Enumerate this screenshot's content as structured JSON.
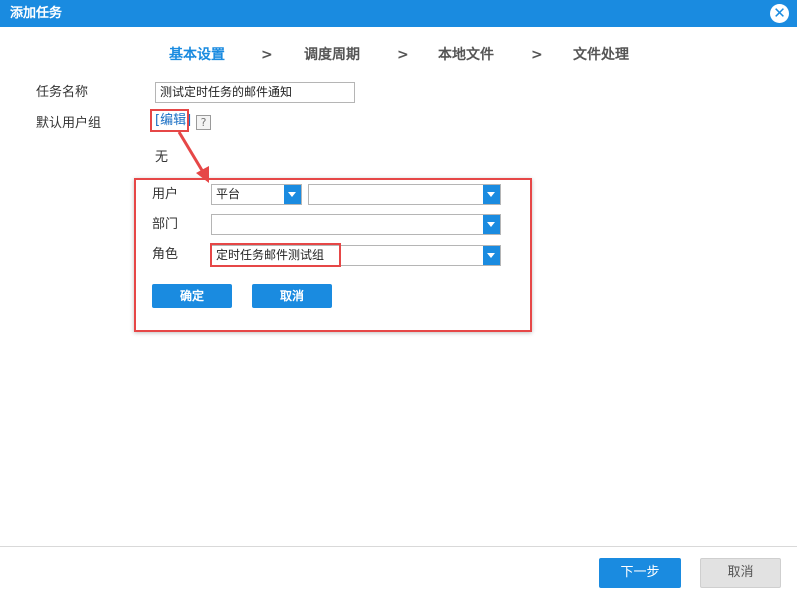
{
  "dialog": {
    "title": "添加任务",
    "close_icon": "close-icon"
  },
  "steps": [
    {
      "label": "基本设置",
      "active": true
    },
    {
      "label": "调度周期",
      "active": false
    },
    {
      "label": "本地文件",
      "active": false
    },
    {
      "label": "文件处理",
      "active": false
    }
  ],
  "step_separator": ">",
  "form": {
    "task_name_label": "任务名称",
    "task_name_value": "测试定时任务的邮件通知",
    "default_group_label": "默认用户组",
    "edit_link": "[编辑]",
    "help_glyph": "?",
    "group_value": "无"
  },
  "panel": {
    "user_label": "用户",
    "user_type_value": "平台",
    "user_value": "",
    "dept_label": "部门",
    "dept_value": "",
    "role_label": "角色",
    "role_value": "定时任务邮件测试组",
    "ok_label": "确定",
    "cancel_label": "取消"
  },
  "footer": {
    "next_label": "下一步",
    "cancel_label": "取消"
  },
  "colors": {
    "accent": "#1a8be0",
    "highlight": "#e64747"
  }
}
